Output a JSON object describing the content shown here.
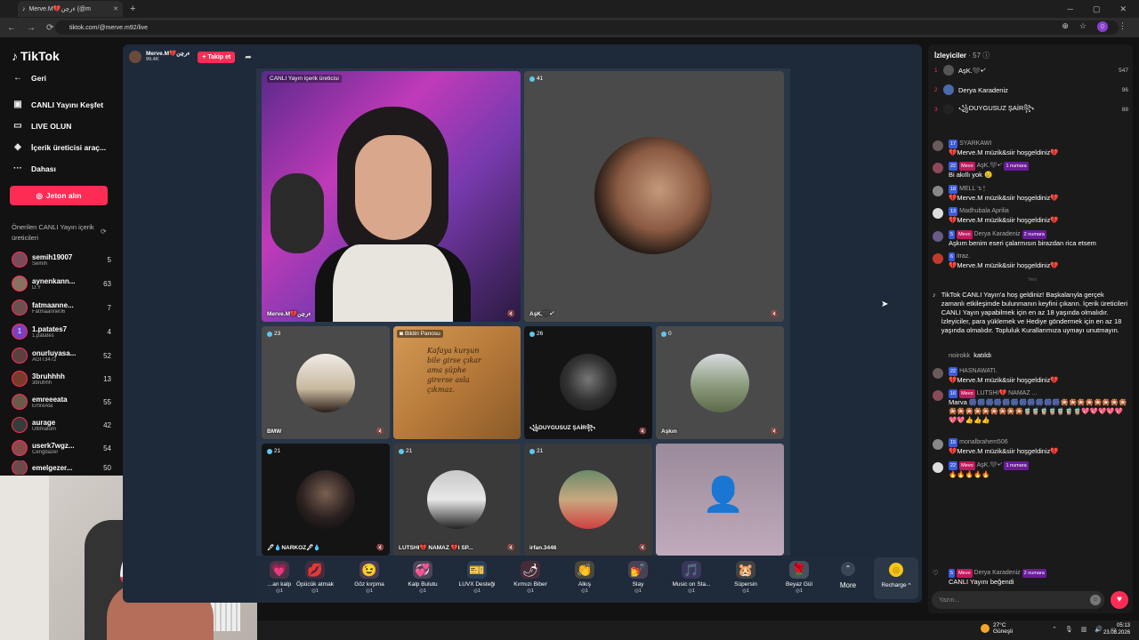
{
  "browser": {
    "tab_title": "Merve.M💔ءرچن (@m",
    "url": "tiktok.com/@merve.m92/live",
    "profile_initial": "0"
  },
  "sidebar": {
    "logo": "TikTok",
    "nav": [
      {
        "label": "Geri",
        "icon": "back-arrow-icon"
      },
      {
        "label": "CANLI Yayını Keşfet",
        "icon": "live-tv-icon"
      },
      {
        "label": "LIVE OLUN",
        "icon": "video-camera-icon"
      },
      {
        "label": "İçerik üreticisi araç...",
        "icon": "creator-tools-icon"
      },
      {
        "label": "Dahası",
        "icon": "more-dots-icon"
      }
    ],
    "jeton_button": "Jeton alın",
    "suggested_title": "Önerilen CANLI Yayın içerik üreticileri",
    "suggested": [
      {
        "name": "semih19007",
        "sub": "Semih",
        "count": "5"
      },
      {
        "name": "aynenkann...",
        "sub": "D.Y",
        "count": "63"
      },
      {
        "name": "fatmaanne...",
        "sub": "Fatmaanne06",
        "count": "7"
      },
      {
        "name": "1.patates7",
        "sub": "1.patates",
        "count": "4"
      },
      {
        "name": "onurluyasa...",
        "sub": "AGİT3472",
        "count": "52"
      },
      {
        "name": "3bruhhhh",
        "sub": "3bruhhh",
        "count": "13"
      },
      {
        "name": "emreeeata",
        "sub": "EmreAta",
        "count": "55"
      },
      {
        "name": "aurage",
        "sub": "Ultimatom",
        "count": "42"
      },
      {
        "name": "userk7wgz...",
        "sub": "Cengbazer",
        "count": "54"
      },
      {
        "name": "emelgezer...",
        "sub": "",
        "count": "50"
      }
    ]
  },
  "host": {
    "name": "Merve.M💔ءرچن",
    "likes": "99.4K",
    "follow": "+ Takip et"
  },
  "tiles": {
    "main_label_top": "CANLI Yayın içerik üreticisi",
    "main_name": "Merve.M💔ءرچن",
    "t2_count": "41",
    "t2_name": "AşK.🖤•ᐟ",
    "t3_count": "23",
    "t3_name": "BMW",
    "t4_label": "Bildiri Panosu",
    "t4_text": "Kafaya kurşun bile girse çıkar ama şüphe girerse asla çıkmaz.",
    "t5_count": "26",
    "t5_name": "꧁DUYGUSUZ ŞAİR꧂",
    "t6_count": "0",
    "t6_name": "Aşkın",
    "t7_count": "21",
    "t7_name": "🖋💧NARKOZ🖋💧",
    "t8_count": "21",
    "t8_name": "LUTSHI💔 NAMAZ 💔I SP...",
    "t9_count": "21",
    "t9_name": "irfan.3446"
  },
  "gifts": [
    {
      "name": "...an kalp",
      "price": "1",
      "emoji": "💗",
      "color": "#ff5a7a"
    },
    {
      "name": "Öpücük atmak",
      "price": "1",
      "emoji": "💋",
      "color": "#e0334f"
    },
    {
      "name": "Göz kırpma",
      "price": "1",
      "emoji": "😉",
      "color": "#f48fb1"
    },
    {
      "name": "Kalp Bulutu",
      "price": "1",
      "emoji": "💞",
      "color": "#f8bbd0"
    },
    {
      "name": "LUVX Desteği",
      "price": "1",
      "emoji": "🎫",
      "color": "#5c9ded"
    },
    {
      "name": "Kırmızı Biber",
      "price": "1",
      "emoji": "🌶",
      "color": "#e53935"
    },
    {
      "name": "Alkış",
      "price": "1",
      "emoji": "👏",
      "color": "#f6c14b"
    },
    {
      "name": "Slay",
      "price": "1",
      "emoji": "💅",
      "color": "#f5a3c7"
    },
    {
      "name": "Music on Sta...",
      "price": "1",
      "emoji": "🎵",
      "color": "#a86df2"
    },
    {
      "name": "Süpersin",
      "price": "1",
      "emoji": "🐹",
      "color": "#d7a86e"
    },
    {
      "name": "Beyaz Gül",
      "price": "1",
      "emoji": "🌹",
      "color": "#f1f1f1"
    }
  ],
  "more_label": "More",
  "recharge_label": "Recharge ^",
  "chat": {
    "viewers_title": "İzleyiciler",
    "viewers_count": "· 57",
    "top": [
      {
        "rank": "1",
        "name": "AşK.🖤•ᐟ",
        "score": "547"
      },
      {
        "rank": "2",
        "name": "Derya Karadeniz",
        "score": "96"
      },
      {
        "rank": "3",
        "name": "꧁DUYGUSUZ ŞAİR꧂",
        "score": "88"
      }
    ],
    "messages": [
      {
        "badges": [
          "17"
        ],
        "name": "SYARKAWI",
        "text": "💔Merve.M müzik&siir hoşgeldiniz💔"
      },
      {
        "badges": [
          "22"
        ],
        "fan": "Mevo",
        "name": "AşK.🖤•ᐟ",
        "num": "1 numara",
        "text": "Bi akıllı yok 😢"
      },
      {
        "badges": [
          "18"
        ],
        "name": "MELL 's 🕯",
        "text": "💔Merve.M müzik&siir hoşgeldiniz💔"
      },
      {
        "badges": [
          "13"
        ],
        "name": "Madhubala Aprilia",
        "text": "💔Merve.M müzik&siir hoşgeldiniz💔"
      },
      {
        "badges": [
          "5"
        ],
        "fan": "Mevo",
        "name": "Derya Karadeniz",
        "num": "2 numara",
        "text": "Aşkım benim eseri çalarmısın birazdan rica etsem"
      },
      {
        "badges": [
          "6"
        ],
        "name": "itraz.",
        "text": "💔Merve.M müzik&siir hoşgeldiniz💔"
      }
    ],
    "sep_new": "Yeni",
    "welcome": "TikTok CANLI Yayın'a hoş geldiniz! Başkalarıyla gerçek zamanlı etkileşimde bulunmanın keyfini çıkarın. İçerik üreticileri CANLI Yayın yapabilmek için en az 18 yaşında olmalıdır. İzleyiciler, para yüklemek ve Hediye göndermek için en az 18 yaşında olmalıdır. Topluluk Kurallarımıza uymayı unutmayın.",
    "joined_name": "noirokk",
    "joined_text": "katıldı",
    "messages2": [
      {
        "badges": [
          "22"
        ],
        "name": "HASNAWATI.",
        "text": "💔Merve.M müzik&siir hoşgeldiniz💔"
      },
      {
        "badges": [
          "16"
        ],
        "fan": "Mevo",
        "name": "LUTSHI💔 NAMAZ ...",
        "text": "Marva 🎆🎆🎆🎆🎆🎆🎆🎆🎆🎆🎆🎇🎇🎇🎇🎇🎇🎇🎇🎇🎇🎇🎇🎇🎇🎇🎇🎇🧋🧋🧋🧋🧋🧋🧋💖💖💖💖💖💖💖👍👍👍"
      },
      {
        "badges": [
          "15"
        ],
        "name": "monalbrahem506",
        "text": "💔Merve.M müzik&siir hoşgeldiniz💔"
      },
      {
        "badges": [
          "22"
        ],
        "fan": "Mevo",
        "name": "AşK.🖤•ᐟ",
        "num": "1 numara",
        "text": "🔥🔥🔥🔥🔥"
      }
    ],
    "like": {
      "badge": "5",
      "fan": "Mevo",
      "name": "Derya Karadeniz",
      "num": "2 numara",
      "text": "CANLI Yayını beğendi"
    },
    "input_placeholder": "Yazın..."
  },
  "taskbar": {
    "temp": "27°C",
    "weather": "Güneşli",
    "time": "05:13",
    "date": "23.08.2026"
  }
}
